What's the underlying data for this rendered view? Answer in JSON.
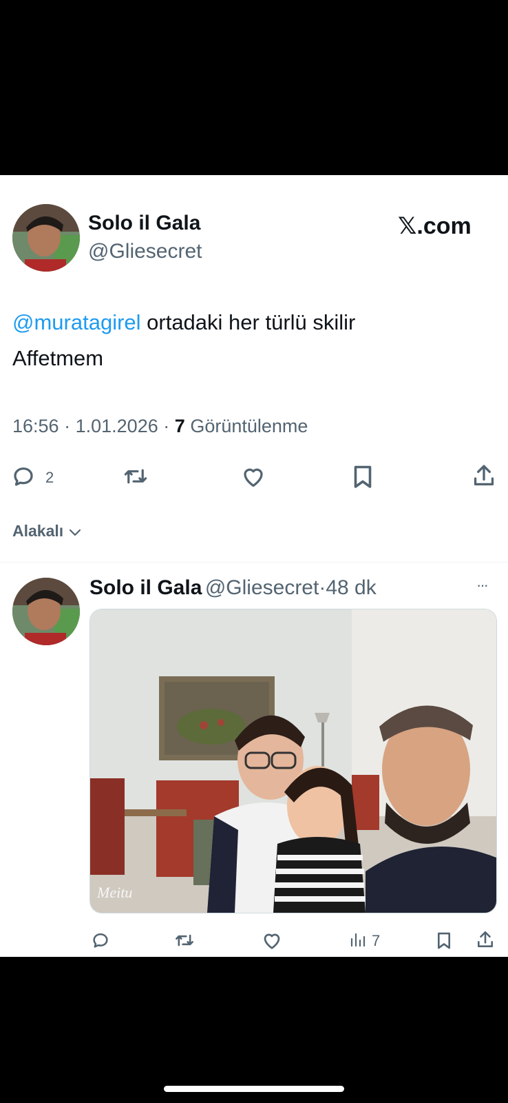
{
  "site_label": "𝕏.com",
  "main_tweet": {
    "name": "Solo il Gala",
    "handle": "@Gliesecret",
    "mention": "@muratagirel",
    "text_rest": " ortadaki her türlü skilir",
    "text_line2": "Affetmem",
    "time": "16:56",
    "date": "1.01.2026",
    "views_count": "7",
    "views_label": "Görüntülenme",
    "sep": "·",
    "reply_count": "2"
  },
  "related_label": "Alakalı",
  "reply_tweet": {
    "name": "Solo il Gala",
    "handle": "@Gliesecret",
    "sep": "·",
    "time_ago": "48 dk",
    "more": "···",
    "image_watermark": "Meitu",
    "views_count": "7"
  },
  "icons": {
    "reply": "reply-icon",
    "retweet": "retweet-icon",
    "like": "like-icon",
    "bookmark": "bookmark-icon",
    "share": "share-icon",
    "views": "views-icon"
  },
  "colors": {
    "mention": "#1d9bf0",
    "secondary_text": "#536471",
    "primary_text": "#0f1419"
  }
}
